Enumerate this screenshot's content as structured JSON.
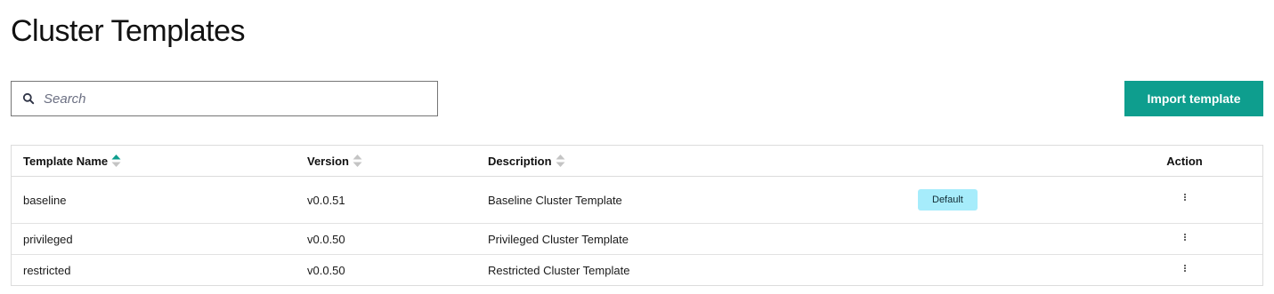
{
  "page": {
    "title": "Cluster Templates"
  },
  "search": {
    "placeholder": "Search",
    "value": "",
    "icon": "search-icon"
  },
  "toolbar": {
    "import_label": "Import template"
  },
  "table": {
    "columns": [
      {
        "label": "Template Name",
        "sort": "ascending"
      },
      {
        "label": "Version",
        "sort": "none"
      },
      {
        "label": "Description",
        "sort": "none"
      },
      {
        "label": "",
        "sort": "none"
      },
      {
        "label": "Action",
        "sort": "none"
      }
    ],
    "rows": [
      {
        "name": "baseline",
        "version": "v0.0.51",
        "description": "Baseline Cluster Template",
        "badge": "Default"
      },
      {
        "name": "privileged",
        "version": "v0.0.50",
        "description": "Privileged Cluster Template",
        "badge": ""
      },
      {
        "name": "restricted",
        "version": "v0.0.50",
        "description": "Restricted Cluster Template",
        "badge": ""
      }
    ]
  },
  "colors": {
    "accent": "#0e9e8e",
    "badge_bg": "#a6ecfb",
    "sort_active": "#0e9e8e",
    "sort_inactive": "#c4c4c4"
  }
}
